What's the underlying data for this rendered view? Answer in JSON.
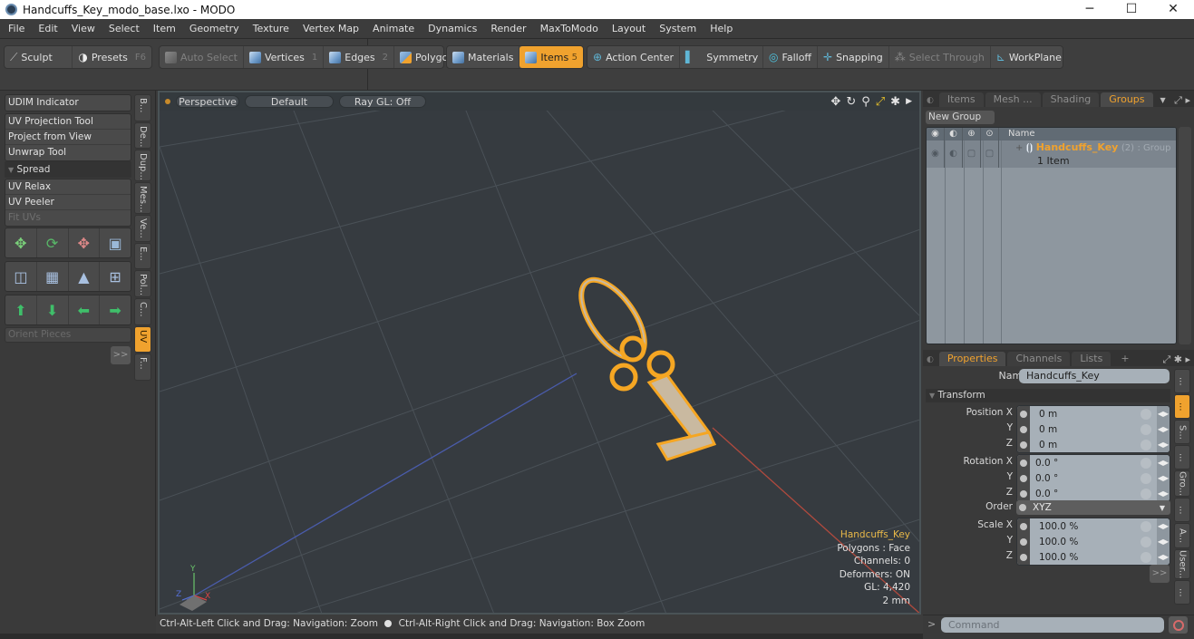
{
  "window": {
    "title": "Handcuffs_Key_modo_base.lxo - MODO",
    "controls": {
      "minimize": "─",
      "maximize": "☐",
      "close": "✕"
    }
  },
  "menu": [
    "File",
    "Edit",
    "View",
    "Select",
    "Item",
    "Geometry",
    "Texture",
    "Vertex Map",
    "Animate",
    "Dynamics",
    "Render",
    "MaxToModo",
    "Layout",
    "System",
    "Help"
  ],
  "toolbar": {
    "sculpt": "Sculpt",
    "presets": "Presets",
    "presets_key": "F6",
    "auto_select": "Auto Select",
    "vertices": "Vertices",
    "vertices_key": "1",
    "edges": "Edges",
    "edges_key": "2",
    "polygons": "Polygons",
    "materials": "Materials",
    "items": "Items",
    "items_key": "5",
    "action_center": "Action Center",
    "symmetry": "Symmetry",
    "falloff": "Falloff",
    "snapping": "Snapping",
    "select_through": "Select Through",
    "workplane": "WorkPlane"
  },
  "left_panel": {
    "udim": "UDIM Indicator",
    "tools1": [
      "UV Projection Tool",
      "Project from View",
      "Unwrap Tool"
    ],
    "spread": "Spread",
    "tools2": [
      "UV Relax",
      "UV Peeler",
      "Fit UVs"
    ],
    "orient": "Orient Pieces",
    "more": ">>",
    "vtabs": [
      "B...",
      "De...",
      "Dup...",
      "Mes...",
      "Ve...",
      "E...",
      "Pol...",
      "C...",
      "UV",
      "F..."
    ],
    "active_vtab": "UV"
  },
  "viewport": {
    "view": "Perspective",
    "shading": "Default",
    "raygl": "Ray GL: Off",
    "info": {
      "item": "Handcuffs_Key",
      "polygons": "Polygons : Face",
      "channels": "Channels: 0",
      "deformers": "Deformers: ON",
      "gl": "GL: 4,420",
      "scale": "2 mm"
    },
    "axis_labels": {
      "x": "X",
      "y": "Y",
      "z": "Z"
    }
  },
  "status": {
    "left": "Ctrl-Alt-Left Click and Drag: Navigation: Zoom",
    "right": "Ctrl-Alt-Right Click and Drag: Navigation: Box Zoom"
  },
  "groups_panel": {
    "tabs": [
      "Items",
      "Mesh ...",
      "Shading",
      "Groups"
    ],
    "active_tab": "Groups",
    "new_group": "New Group",
    "name_header": "Name",
    "rows": [
      {
        "name": "Handcuffs_Key",
        "count": "(2)",
        "type": ": Group",
        "sub": "1 Item"
      }
    ]
  },
  "properties_panel": {
    "tabs": [
      "Properties",
      "Channels",
      "Lists",
      "+"
    ],
    "active_tab": "Properties",
    "name_label": "Name",
    "name_value": "Handcuffs_Key",
    "transform": "Transform",
    "position": {
      "label": "Position X",
      "x": "0 m",
      "y": "0 m",
      "z": "0 m"
    },
    "rotation": {
      "label": "Rotation X",
      "x": "0.0 °",
      "y": "0.0 °",
      "z": "0.0 °"
    },
    "order": {
      "label": "Order",
      "value": "XYZ"
    },
    "scale": {
      "label": "Scale X",
      "x": "100.0 %",
      "y": "100.0 %",
      "z": "100.0 %"
    },
    "axis_y": "Y",
    "axis_z": "Z",
    "more": ">>",
    "vtabs": [
      "...",
      "...",
      "S...",
      "...",
      "Gro...",
      "...",
      "A...",
      "User...",
      "..."
    ]
  },
  "command": {
    "prompt": ">",
    "placeholder": "Command"
  },
  "colors": {
    "accent": "#f0a22e",
    "viewport_bg": "#363b40",
    "key_wire": "#f5a623"
  }
}
